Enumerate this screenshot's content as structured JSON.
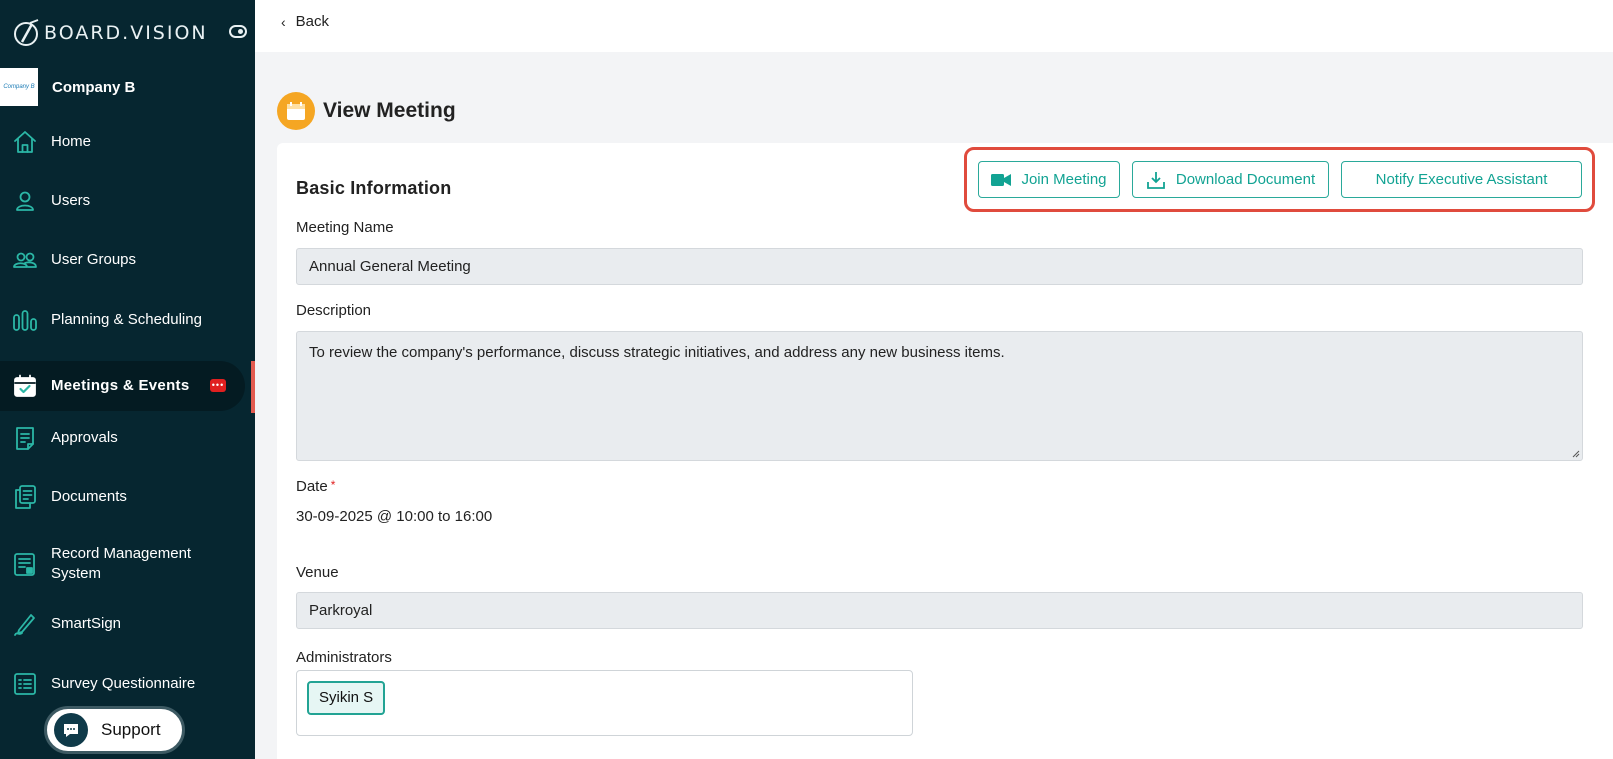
{
  "brand": {
    "name": "BOARD.VISION"
  },
  "company": {
    "name": "Company B",
    "logo_text": "Company B"
  },
  "sidebar": {
    "items": [
      {
        "label": "Home",
        "icon": "home-icon"
      },
      {
        "label": "Users",
        "icon": "user-icon"
      },
      {
        "label": "User Groups",
        "icon": "user-group-icon"
      },
      {
        "label": "Planning & Scheduling",
        "icon": "planning-icon"
      },
      {
        "label": "Meetings & Events",
        "icon": "calendar-check-icon",
        "active": true,
        "badge": "chat-badge-icon"
      },
      {
        "label": "Approvals",
        "icon": "approvals-icon"
      },
      {
        "label": "Documents",
        "icon": "documents-icon"
      },
      {
        "label": "Record Management System",
        "icon": "record-icon"
      },
      {
        "label": "SmartSign",
        "icon": "pen-icon"
      },
      {
        "label": "Survey Questionnaire",
        "icon": "survey-icon"
      }
    ],
    "support_label": "Support"
  },
  "topbar": {
    "back_label": "Back"
  },
  "page": {
    "title": "View Meeting"
  },
  "section": {
    "title": "Basic Information"
  },
  "actions": {
    "join": "Join Meeting",
    "download": "Download Document",
    "notify": "Notify Executive Assistant"
  },
  "fields": {
    "meeting_name": {
      "label": "Meeting Name",
      "value": "Annual General Meeting"
    },
    "description": {
      "label": "Description",
      "value": "To review the company's performance, discuss strategic initiatives, and address any new business items."
    },
    "date": {
      "label": "Date",
      "required_mark": "*",
      "value": "30-09-2025 @ 10:00 to 16:00"
    },
    "venue": {
      "label": "Venue",
      "value": "Parkroyal"
    },
    "administrators": {
      "label": "Administrators",
      "chips": [
        "Syikin S"
      ]
    }
  },
  "colors": {
    "sidebar_bg": "#062630",
    "accent": "#2bb7a6",
    "highlight": "#e04b3d",
    "badge": "#e02020"
  }
}
